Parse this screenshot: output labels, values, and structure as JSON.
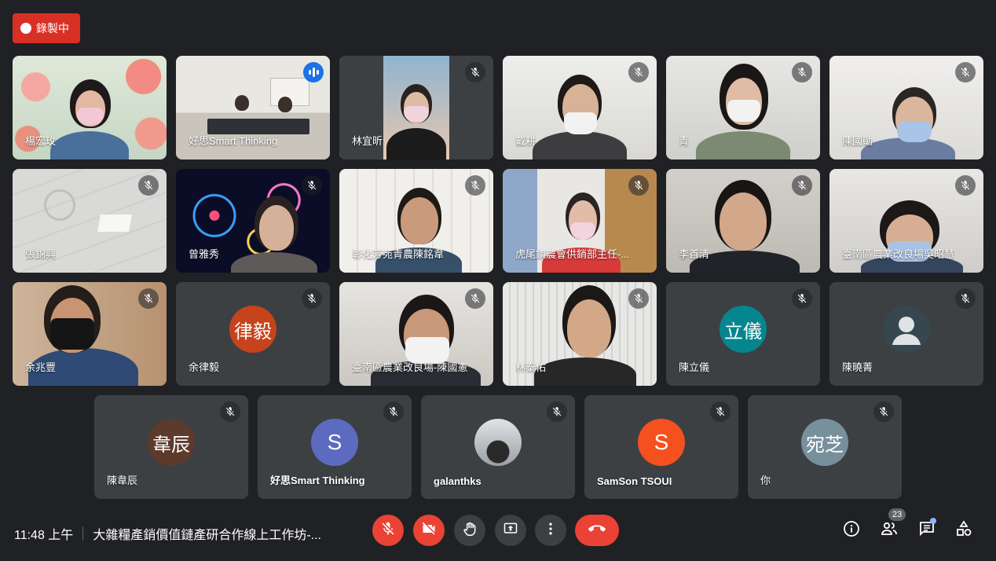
{
  "recording": {
    "label": "錄製中"
  },
  "participants": [
    {
      "name": "楊宏玫"
    },
    {
      "name": "好思Smart Thinking"
    },
    {
      "name": "林宜昕"
    },
    {
      "name": "戴耕"
    },
    {
      "name": "青"
    },
    {
      "name": "陳國勛"
    },
    {
      "name": "張錦興"
    },
    {
      "name": "曾雅秀"
    },
    {
      "name": "彰化芳苑青農陳銘韋"
    },
    {
      "name": "虎尾鎮農會供銷部主任-..."
    },
    {
      "name": "李首清"
    },
    {
      "name": "臺南區農業改良場吳昭慧"
    },
    {
      "name": "余兆豐"
    },
    {
      "name": "余律毅",
      "initials": "律毅"
    },
    {
      "name": "臺南區農業改良場-陳國憲"
    },
    {
      "name": "林泰佑"
    },
    {
      "name": "陳立儀",
      "initials": "立儀"
    },
    {
      "name": "陳曉菁"
    },
    {
      "name": "陳韋辰",
      "initials": "韋辰"
    },
    {
      "name": "好思Smart Thinking",
      "initials": "S"
    },
    {
      "name": "galanthks"
    },
    {
      "name": "SamSon TSOUI",
      "initials": "S"
    },
    {
      "name": "你",
      "initials": "宛芝"
    }
  ],
  "footer": {
    "time": "11:48 上午",
    "meeting_title": "大雜糧產銷價值鏈產研合作線上工作坊-...",
    "participant_count": "23"
  },
  "colors": {
    "background": "#202124",
    "tile": "#3c4043",
    "danger": "#ea4335",
    "accent": "#8ab4f8",
    "avatar_yulyi": "#c5441c",
    "avatar_liyi": "#05868e",
    "avatar_weichen": "#5c3a2c",
    "avatar_smart": "#5c6bc0",
    "avatar_samson": "#f4511e",
    "avatar_wanzhi": "#78909c"
  }
}
